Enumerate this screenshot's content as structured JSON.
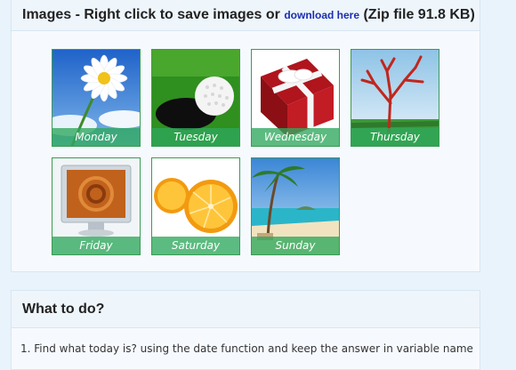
{
  "images_panel": {
    "title_prefix": "Images - Right click to save images or ",
    "download_link": "download here",
    "title_suffix": " (Zip file 91.8 KB)"
  },
  "tiles": [
    {
      "caption": "Monday",
      "image": "daisy-photo"
    },
    {
      "caption": "Tuesday",
      "image": "golf-ball-photo"
    },
    {
      "caption": "Wednesday",
      "image": "gift-box-photo"
    },
    {
      "caption": "Thursday",
      "image": "red-tree-photo"
    },
    {
      "caption": "Friday",
      "image": "monitor-photo"
    },
    {
      "caption": "Saturday",
      "image": "orange-photo"
    },
    {
      "caption": "Sunday",
      "image": "beach-photo"
    }
  ],
  "todo_panel": {
    "title": "What to do?",
    "step_1": "1. Find what today is? using the date function and keep the answer in variable name"
  }
}
